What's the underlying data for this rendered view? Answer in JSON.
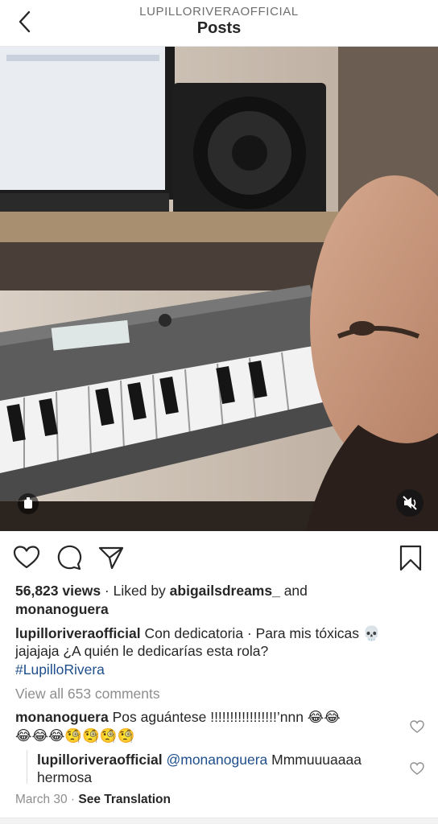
{
  "header": {
    "account": "LUPILLORIVERAOFFICIAL",
    "title": "Posts"
  },
  "video": {
    "muted": true,
    "icons": [
      "reel-icon",
      "muted-speaker-icon"
    ]
  },
  "actions": {
    "icons": [
      "heart-icon",
      "comment-icon",
      "share-icon",
      "bookmark-icon"
    ]
  },
  "stats": {
    "views": "56,823 views",
    "separator": " · ",
    "liked_prefix": "Liked by ",
    "liked_user": "abigailsdreams_",
    "liked_and": " and",
    "liked_user2": "monanoguera"
  },
  "caption": {
    "username": "lupilloriveraofficial",
    "text1": " Con dedicatoria · Para mis tóxicas 💀",
    "text2": "jajajaja ¿A quién le dedicarías esta rola?",
    "hashtag": "#LupilloRivera"
  },
  "view_comments": "View all 653 comments",
  "comments": [
    {
      "username": "monanoguera",
      "text1": " Pos aguántese !!!!!!!!!!!!!!!!!’nnn 😂😂",
      "text2": "😂😂😂🧐🧐🧐🧐"
    }
  ],
  "reply": {
    "username": "lupilloriveraofficial",
    "mention": "@monanoguera",
    "text1": " Mmmuuuaaaa",
    "text2": "hermosa"
  },
  "meta": {
    "date": "March 30",
    "separator": " · ",
    "translate": "See Translation"
  },
  "colors": {
    "text": "#262626",
    "muted": "#8e8e8e",
    "link": "#1e4e8c"
  }
}
